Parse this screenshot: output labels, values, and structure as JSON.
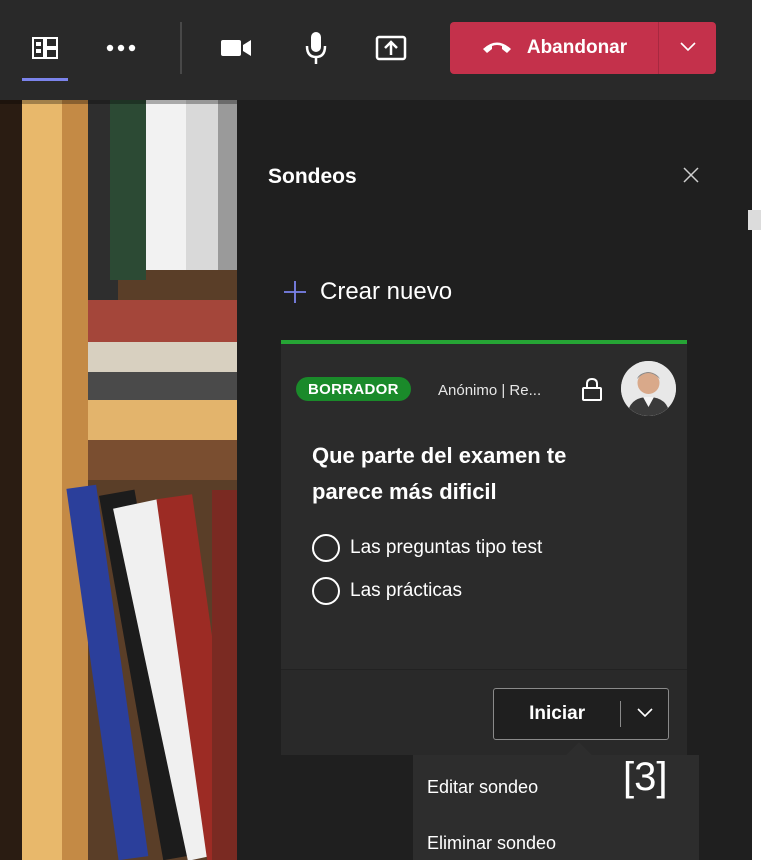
{
  "toolbar": {
    "leave_label": "Abandonar",
    "icons": [
      "apps-icon",
      "more-options-icon",
      "camera-icon",
      "microphone-icon",
      "share-screen-icon",
      "phone-hangup-icon",
      "chevron-down-icon"
    ]
  },
  "panel": {
    "title": "Sondeos",
    "create_new_label": "Crear nuevo"
  },
  "poll": {
    "status_badge": "BORRADOR",
    "meta": "Anónimo | Re...",
    "question": "Que parte del examen te parece más dificil",
    "options": [
      "Las preguntas tipo test",
      "Las prácticas"
    ],
    "start_label": "Iniciar"
  },
  "menu": {
    "items": [
      "Editar sondeo",
      "Eliminar sondeo"
    ]
  },
  "annotation": "[3]",
  "colors": {
    "accent": "#7b83eb",
    "leave_red": "#c4314b",
    "draft_green": "#1a8a2a",
    "card_top_green": "#26a435"
  }
}
